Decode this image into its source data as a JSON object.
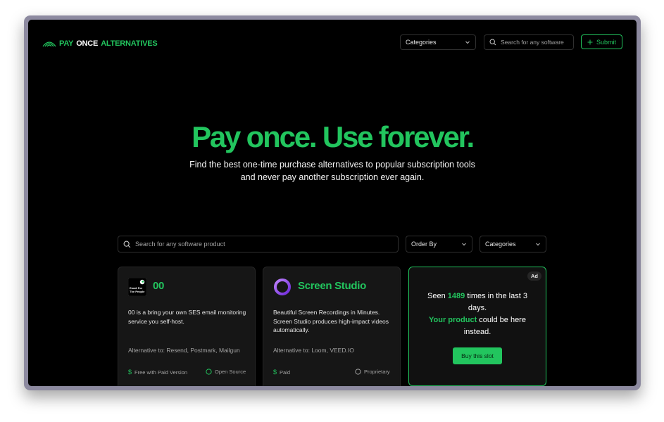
{
  "header": {
    "logo": {
      "word1": "PAY",
      "word2": "ONCE",
      "word3": "ALTERNATIVES"
    },
    "categories_label": "Categories",
    "search_placeholder": "Search for any software",
    "submit_label": "Submit"
  },
  "hero": {
    "title": "Pay once. Use forever.",
    "subtitle_line1": "Find the best one-time purchase alternatives to popular subscription tools",
    "subtitle_line2": "and never pay another subscription ever again."
  },
  "filters": {
    "search_placeholder": "Search for any software product",
    "order_by_label": "Order By",
    "categories_label": "Categories"
  },
  "cards": [
    {
      "name": "00",
      "logo_text": "Email For The People",
      "description": "00 is a bring your own SES email monitoring service you self-host.",
      "alternative_to": "Alternative to: Resend, Postmark, Mailgun",
      "price": "Free with Paid Version",
      "license": "Open Source"
    },
    {
      "name": "Screen Studio",
      "description": "Beautiful Screen Recordings in Minutes. Screen Studio produces high-impact videos automatically.",
      "alternative_to": "Alternative to: Loom, VEED.IO",
      "price": "Paid",
      "license": "Proprietary"
    }
  ],
  "ad": {
    "badge": "Ad",
    "text_before": "Seen ",
    "count": "1489",
    "text_after": " times in the last 3 days.",
    "highlight": "Your product",
    "text_end": " could be here instead.",
    "button_label": "Buy this slot"
  },
  "colors": {
    "accent": "#22c55e",
    "background": "#000000",
    "card": "#161616"
  }
}
